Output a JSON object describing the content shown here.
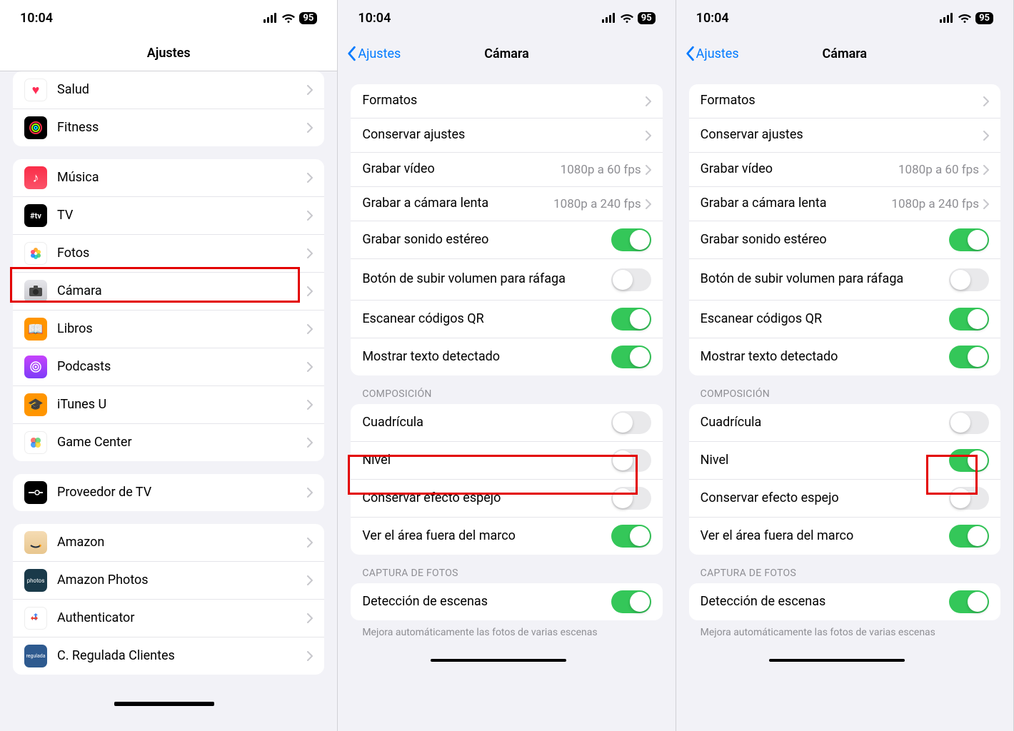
{
  "status": {
    "time": "10:04",
    "battery": "95"
  },
  "screen1": {
    "title": "Ajustes",
    "group1": [
      {
        "label": "Salud",
        "icon": "salud"
      },
      {
        "label": "Fitness",
        "icon": "fitness"
      }
    ],
    "group2": [
      {
        "label": "Música",
        "icon": "musica"
      },
      {
        "label": "TV",
        "icon": "tv"
      },
      {
        "label": "Fotos",
        "icon": "fotos"
      },
      {
        "label": "Cámara",
        "icon": "camara"
      },
      {
        "label": "Libros",
        "icon": "libros"
      },
      {
        "label": "Podcasts",
        "icon": "podcasts"
      },
      {
        "label": "iTunes U",
        "icon": "itunesu"
      },
      {
        "label": "Game Center",
        "icon": "gamecenter"
      }
    ],
    "group3": [
      {
        "label": "Proveedor de TV",
        "icon": "proveedor"
      }
    ],
    "group4": [
      {
        "label": "Amazon",
        "icon": "amazon"
      },
      {
        "label": "Amazon Photos",
        "icon": "amazonphotos"
      },
      {
        "label": "Authenticator",
        "icon": "authenticator"
      },
      {
        "label": "C. Regulada Clientes",
        "icon": "regulada"
      }
    ]
  },
  "camera": {
    "back": "Ajustes",
    "title": "Cámara",
    "rows": {
      "formatos": "Formatos",
      "conservar": "Conservar ajustes",
      "grabarVideo": "Grabar vídeo",
      "grabarVideoDetail": "1080p a 60 fps",
      "grabarLenta": "Grabar a cámara lenta",
      "grabarLentaDetail": "1080p a 240 fps",
      "sonidoEstereo": "Grabar sonido estéreo",
      "volumenRafaga": "Botón de subir volumen para ráfaga",
      "escanearQR": "Escanear códigos QR",
      "textoDetectado": "Mostrar texto detectado"
    },
    "composicion": {
      "header": "COMPOSICIÓN",
      "cuadricula": "Cuadrícula",
      "nivel": "Nivel",
      "espejo": "Conservar efecto espejo",
      "fueraMarco": "Ver el área fuera del marco"
    },
    "captura": {
      "header": "CAPTURA DE FOTOS",
      "deteccion": "Detección de escenas",
      "footer": "Mejora automáticamente las fotos de varias escenas"
    }
  }
}
